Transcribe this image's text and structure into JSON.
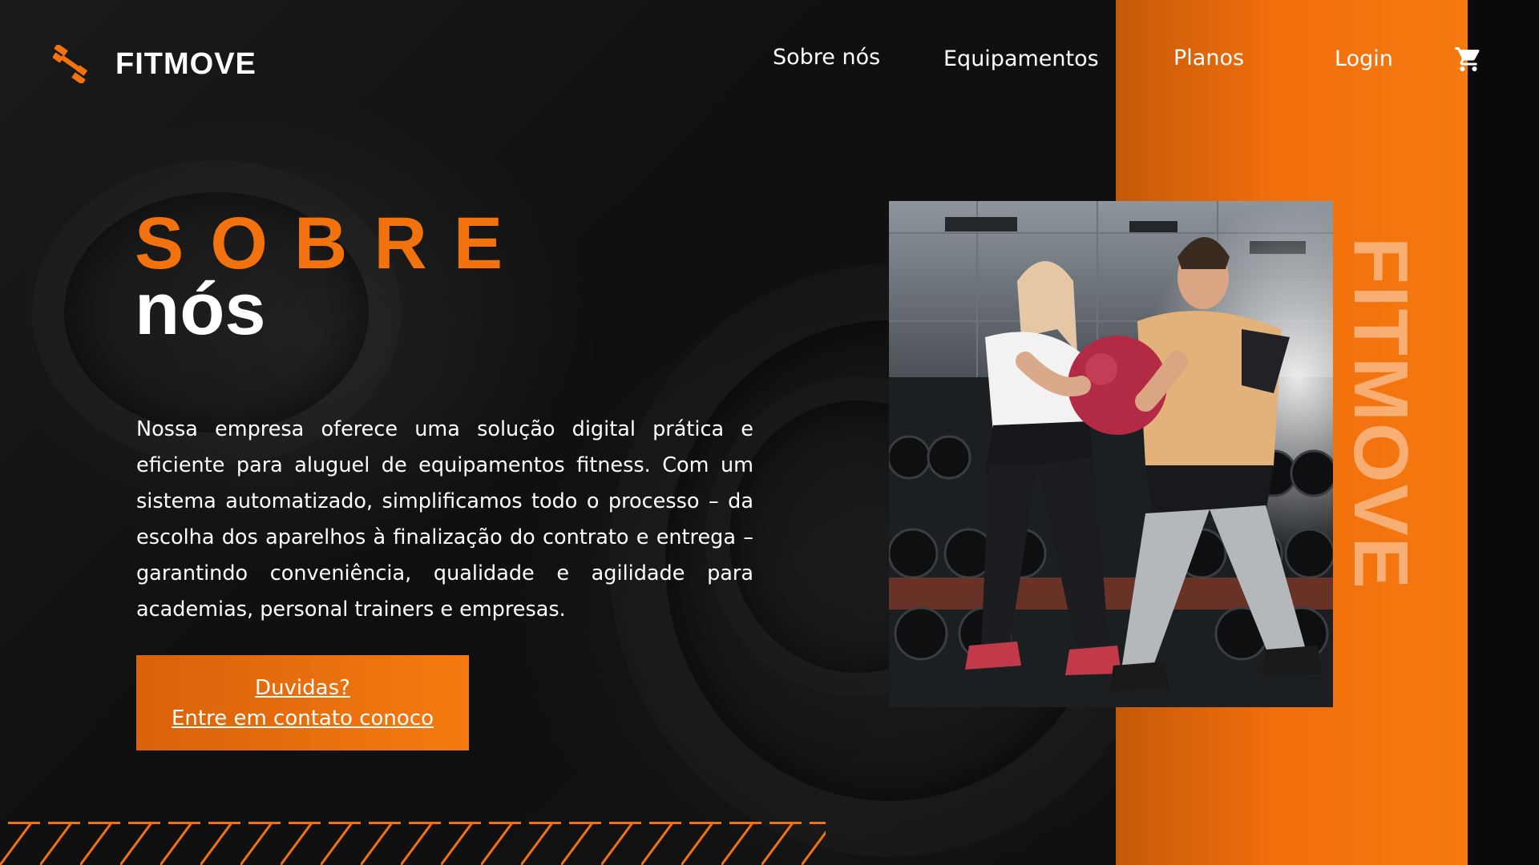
{
  "brand": {
    "name": "FITMOVE",
    "logo_icon": "dumbbell-icon"
  },
  "nav": {
    "items": [
      "Sobre nós",
      "Equipamentos",
      "Planos",
      "Login"
    ],
    "cart_icon": "shopping-cart-icon"
  },
  "hero": {
    "title_line1": "SOBRE",
    "title_line2": "nós",
    "description": "Nossa empresa oferece uma solução digital prática e eficiente para aluguel de equipamentos fitness. Com um sistema automatizado, simplificamos todo o processo – da escolha dos aparelhos à finalização do contrato e entrega – garantindo conveniência, qualidade e agilidade para academias, personal trainers e empresas.",
    "cta_line1": "Duvidas?",
    "cta_line2": "Entre em contato conoco"
  },
  "side": {
    "vertical_text": "FITMOVE"
  },
  "colors": {
    "accent": "#f2730d",
    "background": "#0b0b0b",
    "text": "#ffffff"
  }
}
